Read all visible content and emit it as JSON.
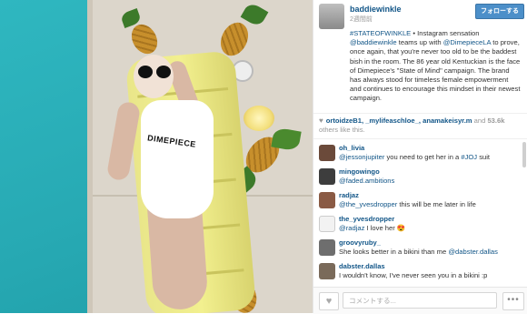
{
  "header": {
    "username": "baddiewinkle",
    "time_ago": "2週間前",
    "follow_label": "フォローする"
  },
  "caption": {
    "hashtag": "#STATEOFWINKLE",
    "text_1": " • Instagram sensation ",
    "mention_1": "@baddiewinkle",
    "text_2": " teams up with ",
    "mention_2": "@DimepieceLA",
    "text_3": " to prove, once again, that you're never too old to be the baddest bish in the room. The 86 year old Kentuckian is the face of Dimepiece's \"State of Mind\" campaign. The brand has always stood for timeless female empowerment and continues to encourage this mindset in their newest campaign."
  },
  "likes": {
    "users": "ortoidzeB1, _mylifeaschloe_, anamakeisyr.m",
    "and": " and ",
    "count": "53.6k",
    "suffix": "others like this."
  },
  "comments": [
    {
      "user": "oh_livia",
      "text_pre": "",
      "mention": "@jessonjupiter",
      "text_post": " you need to get her in a ",
      "tag": "#JOJ",
      "text_end": " suit",
      "avatar_color": "#6b4a3a"
    },
    {
      "user": "mingowingo",
      "text_pre": "",
      "mention": "@faded.ambitions",
      "text_post": "",
      "tag": "",
      "text_end": "",
      "avatar_color": "#3d3d3d"
    },
    {
      "user": "radjaz",
      "text_pre": "",
      "mention": "@the_yvesdropper",
      "text_post": " this will be me later in life",
      "tag": "",
      "text_end": "",
      "avatar_color": "#8a5a44"
    },
    {
      "user": "the_yvesdropper",
      "text_pre": "",
      "mention": "@radjaz",
      "text_post": " I love her 😍",
      "tag": "",
      "text_end": "",
      "avatar_color": "#f2f2f2"
    },
    {
      "user": "groovyruby_",
      "text_pre": "She looks better in a bikini than me ",
      "mention": "@dabster.dallas",
      "text_post": "",
      "tag": "",
      "text_end": "",
      "avatar_color": "#6e6e6e"
    },
    {
      "user": "dabster.dallas",
      "text_pre": "I wouldn't know, I've never seen you in a bikini :p",
      "mention": "",
      "text_post": "",
      "tag": "",
      "text_end": "",
      "avatar_color": "#7a6a5a"
    }
  ],
  "footer": {
    "like_icon": "heart-icon",
    "comment_placeholder": "コメントする...",
    "more_label": "•••"
  },
  "photo": {
    "shirt_text": "DIMEPIECE"
  }
}
